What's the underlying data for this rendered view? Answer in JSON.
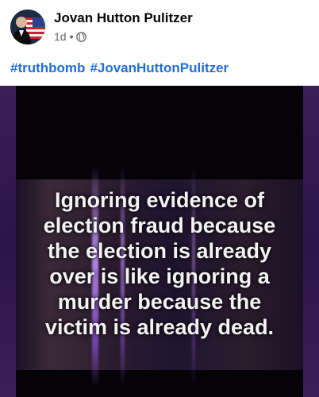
{
  "post": {
    "author": "Jovan Hutton Pulitzer",
    "time": "1d",
    "separator": "•",
    "privacy_icon": "globe-icon",
    "hashtags": [
      "#truthbomb",
      "#JovanHuttonPulitzer"
    ]
  },
  "image": {
    "quote_lines": [
      "Ignoring evidence of",
      "election fraud because",
      "the election is already",
      "over is like ignoring a",
      "murder because the",
      "victim is already dead."
    ]
  },
  "colors": {
    "hashtag": "#216fdb",
    "author": "#050505",
    "meta": "#65676b",
    "image_frame": "#2a1645"
  }
}
